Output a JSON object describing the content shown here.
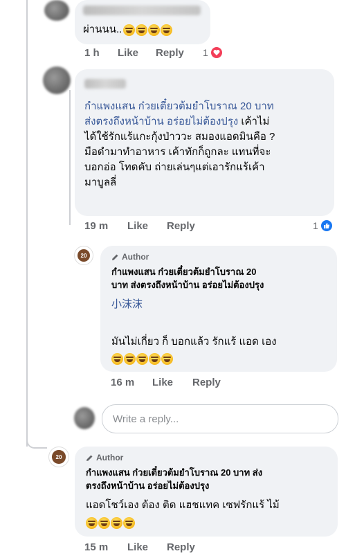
{
  "comments": [
    {
      "id": "c1",
      "text": "ผ่านนน..",
      "meta": {
        "time": "1 h",
        "like": "Like",
        "reply": "Reply",
        "reaction_count": "1"
      },
      "reaction": "love-icon"
    },
    {
      "id": "c2",
      "link_text_1": "กำแพงแสน ก๋วยเตี๋ยวต้มยำโบราณ 20 บาท",
      "link_text_2": "ส่งตรงถึงหน้าบ้าน อร่อยไม่ต้องปรุง",
      "line_2_suffix": " เค้าไม่",
      "line_3": "ได้ใช้รักแร้แกะกุ้งป่าววะ สมองแอดมินคือ ?",
      "line_4": "มือดำมาทำอาหาร เค้าทักก็ถูกละ แทนที่จะ",
      "line_5": "บอกอ่อ โทดคับ ถ่ายเล่นๆแต่เอารักแร้เค้า",
      "line_6": "มาบูลลี่",
      "meta": {
        "time": "19 m",
        "like": "Like",
        "reply": "Reply",
        "reaction_count": "1"
      },
      "reaction": "like-icon"
    },
    {
      "id": "r1",
      "author_label": "Author",
      "name_line_1": "กำแพงแสน ก๋วยเตี๋ยวต้มยำโบราณ 20",
      "name_line_2": "บาท ส่งตรงถึงหน้าบ้าน อร่อยไม่ต้องปรุง",
      "mention": "小沫沫",
      "text": "มันไม่เกี่ยว ก็ บอกแล้ว รักแร้ แอด เอง",
      "meta": {
        "time": "16 m",
        "like": "Like",
        "reply": "Reply"
      }
    },
    {
      "id": "c3",
      "author_label": "Author",
      "name_line_1": "กำแพงแสน ก๋วยเตี๋ยวต้มยำโบราณ 20 บาท ส่ง",
      "name_line_2": "ตรงถึงหน้าบ้าน อร่อยไม่ต้องปรุง",
      "text": "แอดโชว์เอง ต้อง ติด แฮชแทค เซฟรักแร้ ไม้",
      "meta": {
        "time": "15 m",
        "like": "Like",
        "reply": "Reply"
      }
    }
  ],
  "reply_box": {
    "placeholder": "Write a reply..."
  },
  "page_avatar": {
    "text": "20"
  },
  "colors": {
    "bubble": "#f0f2f5",
    "link": "#385898",
    "meta": "#65676b",
    "love": "#f33e58",
    "like": "#1877f2"
  }
}
